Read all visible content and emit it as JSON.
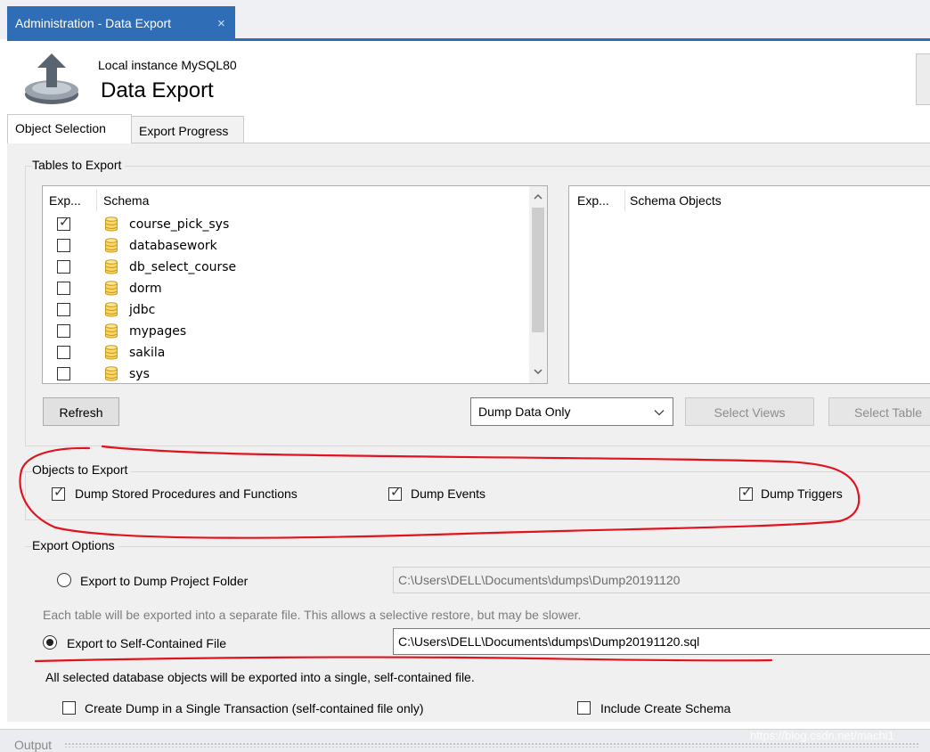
{
  "window": {
    "tab_title": "Administration - Data Export",
    "tab_close": "×"
  },
  "header": {
    "instance": "Local instance MySQL80",
    "title": "Data Export"
  },
  "tabs": [
    {
      "label": "Object Selection",
      "active": true
    },
    {
      "label": "Export Progress",
      "active": false
    }
  ],
  "tables_to_export": {
    "label": "Tables to Export",
    "left_list": {
      "col_export": "Exp...",
      "col_schema": "Schema",
      "rows": [
        {
          "name": "course_pick_sys",
          "checked": true
        },
        {
          "name": "databasework",
          "checked": false
        },
        {
          "name": "db_select_course",
          "checked": false
        },
        {
          "name": "dorm",
          "checked": false
        },
        {
          "name": "jdbc",
          "checked": false
        },
        {
          "name": "mypages",
          "checked": false
        },
        {
          "name": "sakila",
          "checked": false
        },
        {
          "name": "sys",
          "checked": false
        }
      ]
    },
    "right_list": {
      "col_export": "Exp...",
      "col_objects": "Schema Objects"
    },
    "refresh_label": "Refresh",
    "dump_mode": "Dump Data Only",
    "select_views_label": "Select Views",
    "select_tables_label": "Select Table"
  },
  "objects_to_export": {
    "label": "Objects to Export",
    "options": [
      {
        "label": "Dump Stored Procedures and Functions",
        "checked": true
      },
      {
        "label": "Dump Events",
        "checked": true
      },
      {
        "label": "Dump Triggers",
        "checked": true
      }
    ]
  },
  "export_options": {
    "label": "Export Options",
    "folder_option": "Export to Dump Project Folder",
    "folder_path": "C:\\Users\\DELL\\Documents\\dumps\\Dump20191120",
    "folder_note": "Each table will be exported into a separate file. This allows a selective restore, but may be slower.",
    "file_option": "Export to Self-Contained File",
    "file_path": "C:\\Users\\DELL\\Documents\\dumps\\Dump20191120.sql",
    "file_note": "All selected database objects will be exported into a single, self-contained file.",
    "single_transaction": "Create Dump in a Single Transaction (self-contained file only)",
    "include_schema": "Include Create Schema",
    "selected": "file"
  },
  "output": {
    "label": "Output"
  },
  "watermark": "https://blog.csdn.net/machi1",
  "colors": {
    "accent": "#2f6db6",
    "annotation": "#e0141e"
  }
}
